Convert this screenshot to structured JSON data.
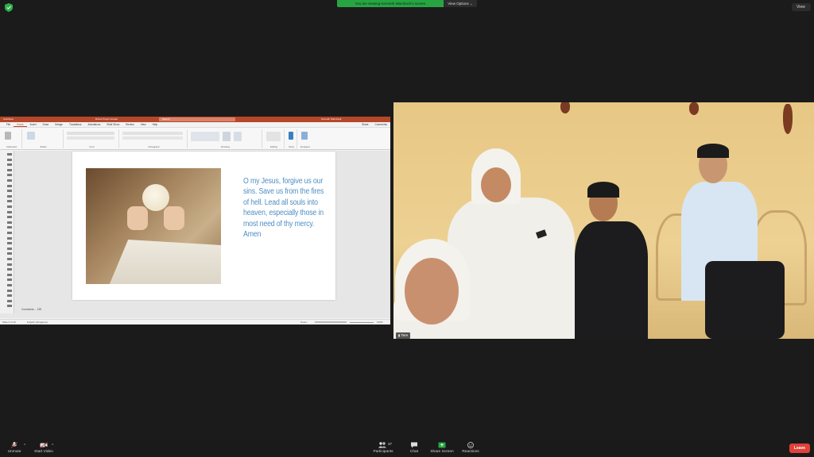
{
  "top": {
    "share_banner": "You are viewing Kenneth Warnbock's screen",
    "view_options": "View Options ⌄",
    "view_button": "View"
  },
  "ppt": {
    "title_left": "AutoSave",
    "file_name": "Divine Prayer Acosta",
    "search": "Search",
    "account": "Kenneth Warnbock",
    "share": "Share",
    "comments": "Comments",
    "menu": [
      "File",
      "Home",
      "Insert",
      "Draw",
      "Design",
      "Transitions",
      "Animations",
      "Slide Show",
      "Review",
      "View",
      "Help"
    ],
    "ribbon_groups": [
      "Clipboard",
      "Slides",
      "Font",
      "Paragraph",
      "Drawing",
      "Editing",
      "Voice",
      "Designer"
    ],
    "slide_text": "O my Jesus, forgive us our sins. Save us from the fires of hell. Lead all souls into heaven, especially those in most need of thy mercy. Amen",
    "comments_bar": "Comments ... 190",
    "status_left": "Slide 3 of 40",
    "status_lang": "English (Singapore)",
    "status_notes": "Notes",
    "zoom": "100%"
  },
  "video": {
    "participant_name": "Tere"
  },
  "toolbar": {
    "unmute": "Unmute",
    "start_video": "Start Video",
    "participants": "Participants",
    "participants_count": "37",
    "chat": "Chat",
    "share_screen": "Share Screen",
    "reactions": "Reactions",
    "leave": "Leave"
  },
  "colors": {
    "share_green": "#27a543",
    "leave_red": "#e0413a",
    "ppt_red": "#b7472a",
    "slide_text_blue": "#4f8fc4"
  }
}
